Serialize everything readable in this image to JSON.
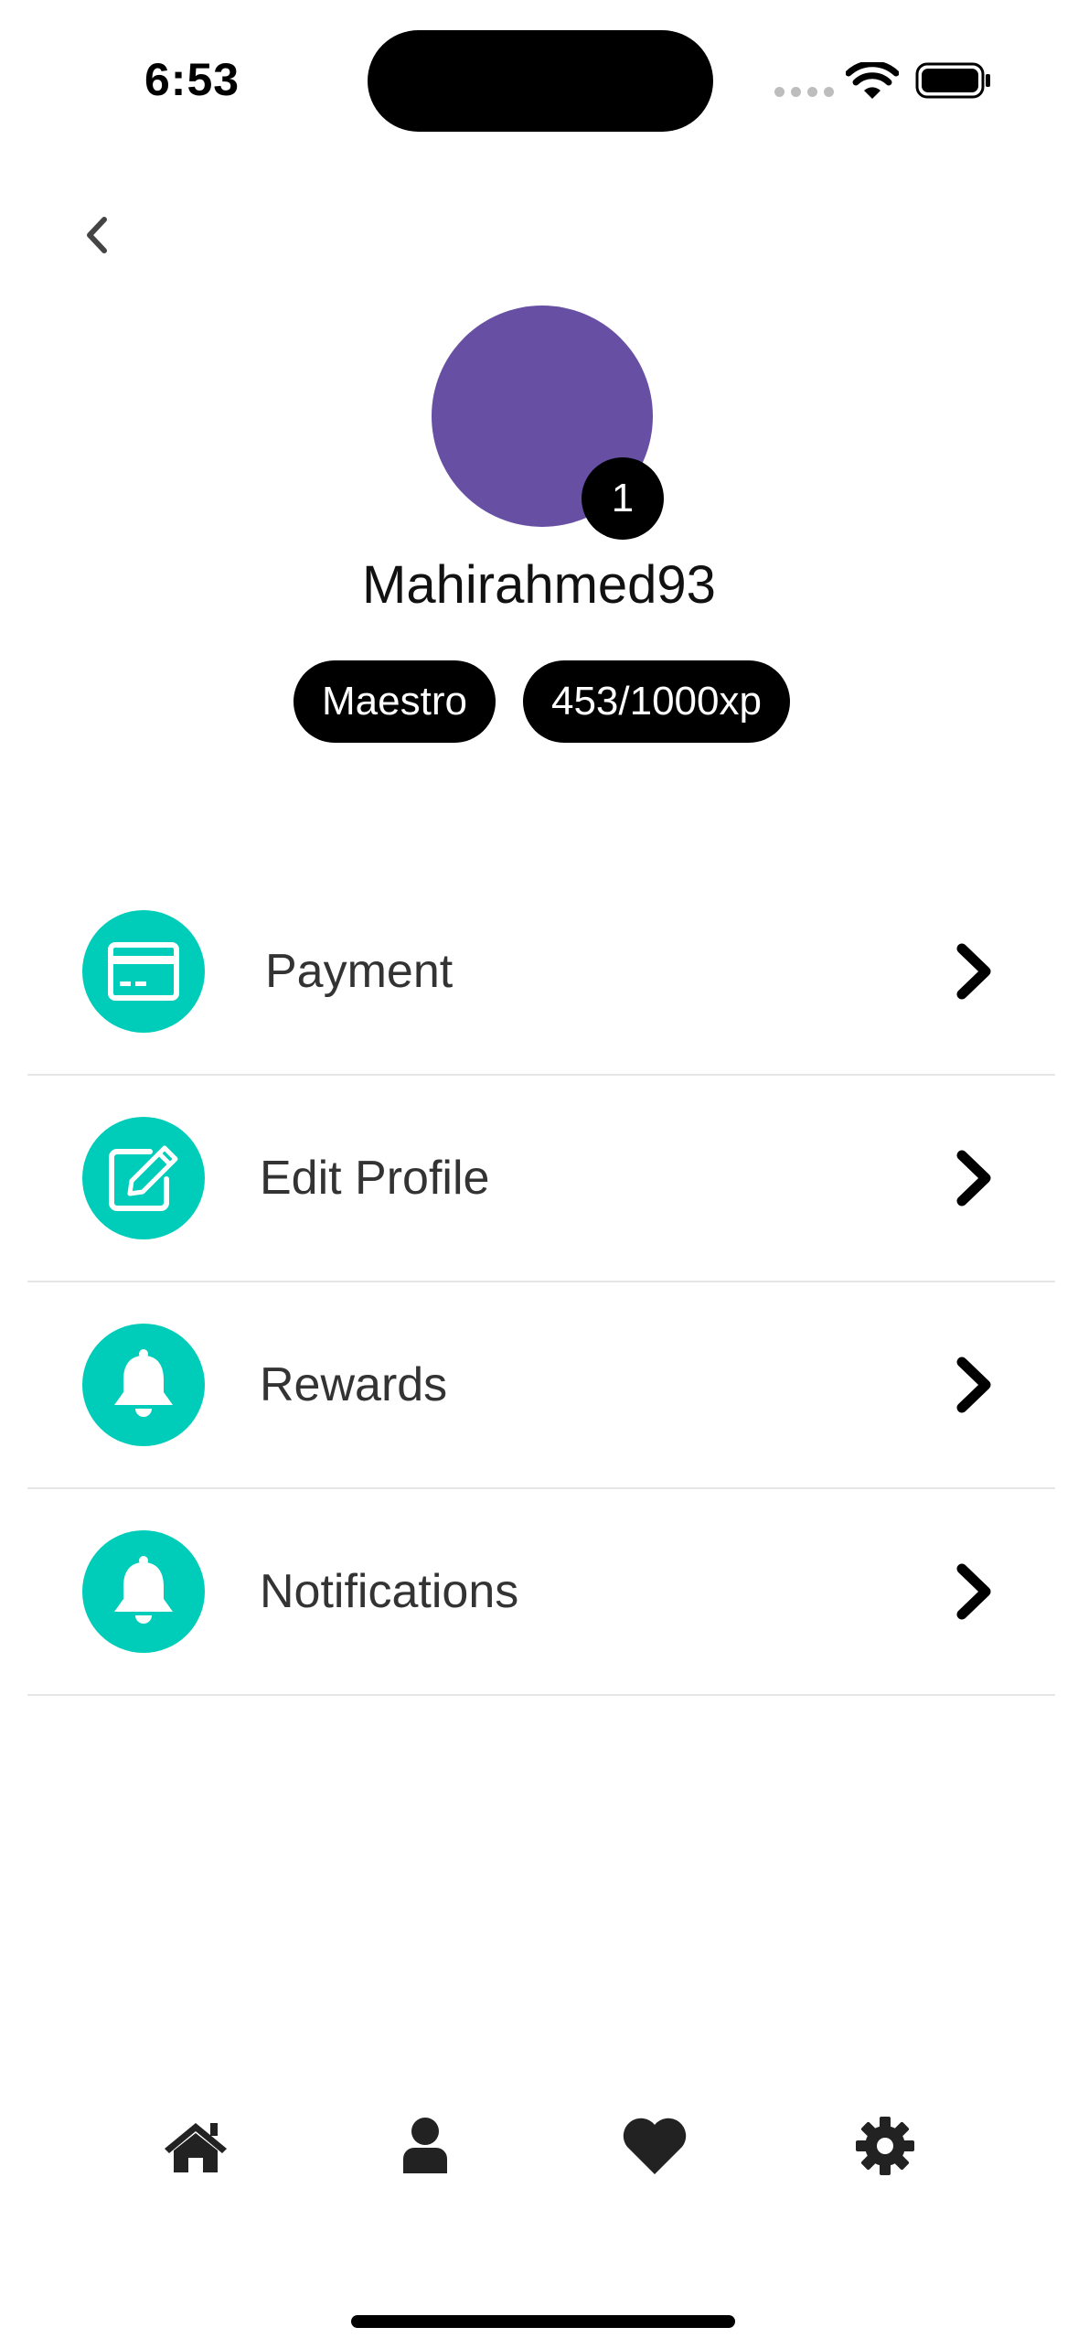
{
  "status_bar": {
    "time": "6:53"
  },
  "profile": {
    "username": "Mahirahmed93",
    "level": "1",
    "avatar_color": "#6750a4",
    "badges": [
      "Maestro",
      "453/1000xp"
    ]
  },
  "menu": {
    "items": [
      {
        "label": "Payment",
        "icon": "credit-card-icon"
      },
      {
        "label": "Edit Profile",
        "icon": "edit-icon"
      },
      {
        "label": "Rewards",
        "icon": "bell-icon"
      },
      {
        "label": "Notifications",
        "icon": "bell-icon"
      }
    ],
    "icon_bg": "#00cdb9"
  },
  "tab_bar": {
    "items": [
      "home-icon",
      "user-icon",
      "heart-icon",
      "gear-icon"
    ]
  }
}
